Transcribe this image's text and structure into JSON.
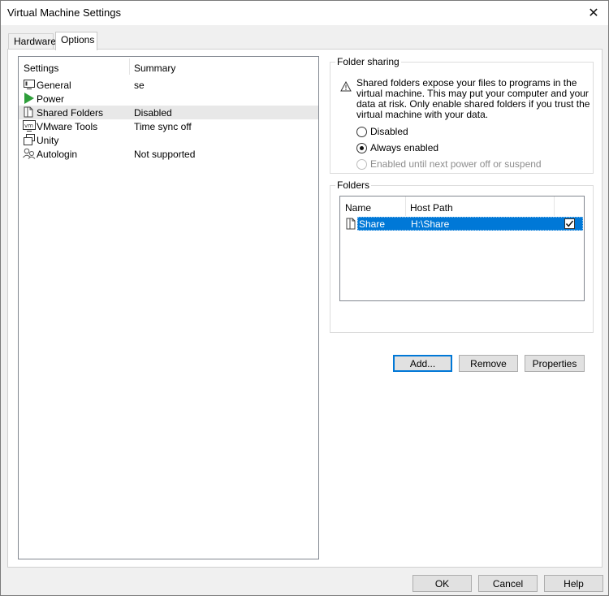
{
  "window": {
    "title": "Virtual Machine Settings"
  },
  "tabs": [
    {
      "label": "Hardware"
    },
    {
      "label": "Options"
    }
  ],
  "settings_list": {
    "header_settings": "Settings",
    "header_summary": "Summary",
    "items": [
      {
        "name": "General",
        "summary": "se",
        "icon": "monitor-icon"
      },
      {
        "name": "Power",
        "summary": "",
        "icon": "play-icon"
      },
      {
        "name": "Shared Folders",
        "summary": "Disabled",
        "icon": "shared-folder-icon"
      },
      {
        "name": "VMware Tools",
        "summary": "Time sync off",
        "icon": "vm-icon"
      },
      {
        "name": "Unity",
        "summary": "",
        "icon": "unity-icon"
      },
      {
        "name": "Autologin",
        "summary": "Not supported",
        "icon": "users-icon"
      }
    ]
  },
  "folder_sharing": {
    "title": "Folder sharing",
    "warning": "Shared folders expose your files to programs in the virtual machine. This may put your computer and your data at risk. Only enable shared folders if you trust the virtual machine with your data.",
    "options": [
      {
        "label": "Disabled"
      },
      {
        "label": "Always enabled"
      },
      {
        "label": "Enabled until next power off or suspend"
      }
    ]
  },
  "folders": {
    "title": "Folders",
    "col_name": "Name",
    "col_host_path": "Host Path",
    "rows": [
      {
        "name": "Share",
        "host_path": "H:\\Share"
      }
    ],
    "add_label": "Add...",
    "remove_label": "Remove",
    "properties_label": "Properties"
  },
  "footer": {
    "ok_label": "OK",
    "cancel_label": "Cancel",
    "help_label": "Help"
  },
  "colors": {
    "selection": "#0078d7",
    "power_green": "#2e9e3a"
  }
}
